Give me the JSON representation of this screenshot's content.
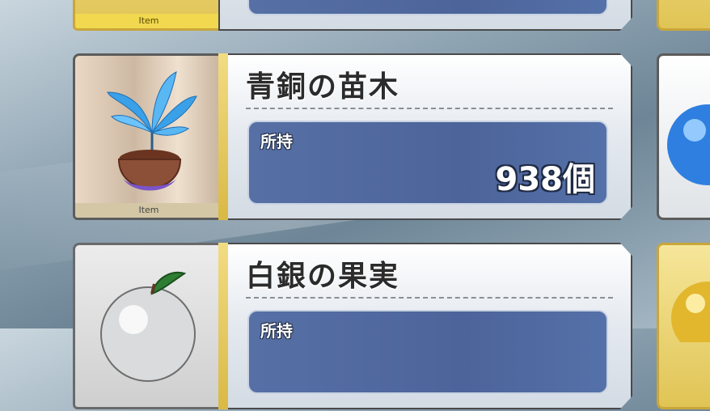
{
  "items": [
    {
      "caption": "Item",
      "style": "gold"
    },
    {
      "name": "青銅の苗木",
      "owned_label": "所持",
      "owned_value": "938個",
      "caption": "Item",
      "icon": "blue-sapling-icon"
    },
    {
      "name": "白銀の果実",
      "owned_label": "所持",
      "icon": "silver-apple-icon"
    }
  ],
  "colors": {
    "panel_blue": "#4c6499",
    "gold_accent": "#e0c455"
  }
}
